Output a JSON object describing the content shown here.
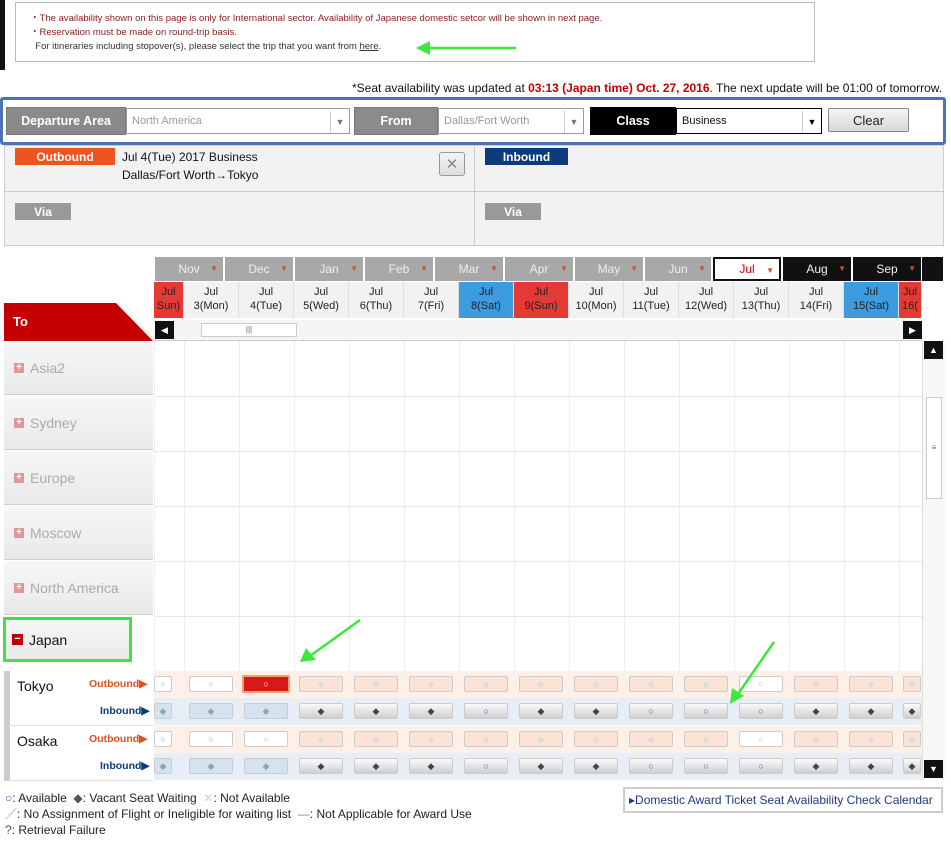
{
  "notice": {
    "line1": "The availability shown on this page is only for International sector. Availability of Japanese domestic setcor will be shown in next page.",
    "line2": "Reservation must be made on round-trip basis.",
    "line3": "For itineraries including stopover(s), please select the trip that you want from",
    "link": "here",
    "period": "."
  },
  "updated": {
    "prefix": "*Seat availability was updated at ",
    "time": "03:13 (Japan time) Oct. 27, 2016",
    "suffix": ". The next update will be 01:00 of tomorrow."
  },
  "selectors": {
    "departure_label": "Departure Area",
    "departure_value": "North America",
    "from_label": "From",
    "from_value": "Dallas/Fort Worth",
    "class_label": "Class",
    "class_value": "Business",
    "clear": "Clear"
  },
  "trip": {
    "outbound_label": "Outbound",
    "outbound_line1": "Jul 4(Tue) 2017   Business",
    "outbound_line2": "Dallas/Fort Worth→Tokyo",
    "inbound_label": "Inbound",
    "via1": "Via",
    "via2": "Via"
  },
  "months": [
    "Nov",
    "Dec",
    "Jan",
    "Feb",
    "Mar",
    "Apr",
    "May",
    "Jun",
    "Jul",
    "Aug",
    "Sep"
  ],
  "days": [
    {
      "m": "Jul",
      "d": "Sun)"
    },
    {
      "m": "Jul",
      "d": "3(Mon)"
    },
    {
      "m": "Jul",
      "d": "4(Tue)"
    },
    {
      "m": "Jul",
      "d": "5(Wed)"
    },
    {
      "m": "Jul",
      "d": "6(Thu)"
    },
    {
      "m": "Jul",
      "d": "7(Fri)"
    },
    {
      "m": "Jul",
      "d": "8(Sat)"
    },
    {
      "m": "Jul",
      "d": "9(Sun)"
    },
    {
      "m": "Jul",
      "d": "10(Mon)"
    },
    {
      "m": "Jul",
      "d": "11(Tue)"
    },
    {
      "m": "Jul",
      "d": "12(Wed)"
    },
    {
      "m": "Jul",
      "d": "13(Thu)"
    },
    {
      "m": "Jul",
      "d": "14(Fri)"
    },
    {
      "m": "Jul",
      "d": "15(Sat)"
    },
    {
      "m": "Jul",
      "d": "16("
    }
  ],
  "to_header": "To",
  "regions": [
    "Asia2",
    "Sydney",
    "Europe",
    "Moscow",
    "North America"
  ],
  "japan": "Japan",
  "cities": [
    {
      "name": "Tokyo",
      "outbound": "Outbound▶",
      "inbound": "Inbound▶",
      "out_cells": [
        "○",
        "○",
        "○",
        "◆",
        "◆",
        "◆",
        "◆",
        "◆",
        "◆",
        "◆",
        "◆",
        "○",
        "◆",
        "◆",
        "◆"
      ],
      "in_cells": [
        "◆",
        "◆",
        "◆",
        "◆",
        "◆",
        "◆",
        "○",
        "◆",
        "◆",
        "○",
        "○",
        "○",
        "◆",
        "◆",
        "◆"
      ]
    },
    {
      "name": "Osaka",
      "outbound": "Outbound▶",
      "inbound": "Inbound▶",
      "out_cells": [
        "○",
        "○",
        "○",
        "◆",
        "◆",
        "◆",
        "◆",
        "◆",
        "◆",
        "◆",
        "◆",
        "○",
        "◆",
        "◆",
        "◆"
      ],
      "in_cells": [
        "◆",
        "◆",
        "◆",
        "◆",
        "◆",
        "◆",
        "○",
        "◆",
        "◆",
        "○",
        "○",
        "○",
        "◆",
        "◆",
        "◆"
      ]
    }
  ],
  "legend": {
    "available": ": Available",
    "waiting": ": Vacant Seat Waiting",
    "not_available": ": Not Available",
    "no_assignment": ": No Assignment of Flight or Ineligible for waiting list",
    "not_applicable": ": Not Applicable for Award Use",
    "retrieval": ": Retrieval Failure"
  },
  "domestic_link": "▸Domestic Award Ticket Seat Availability Check Calendar",
  "colors": {
    "accent_red": "#c40000",
    "inbound_blue": "#0d3a7a",
    "outbound_orange": "#f0541e",
    "selector_border": "#4a73b5",
    "highlight_green": "#2ee82e"
  }
}
